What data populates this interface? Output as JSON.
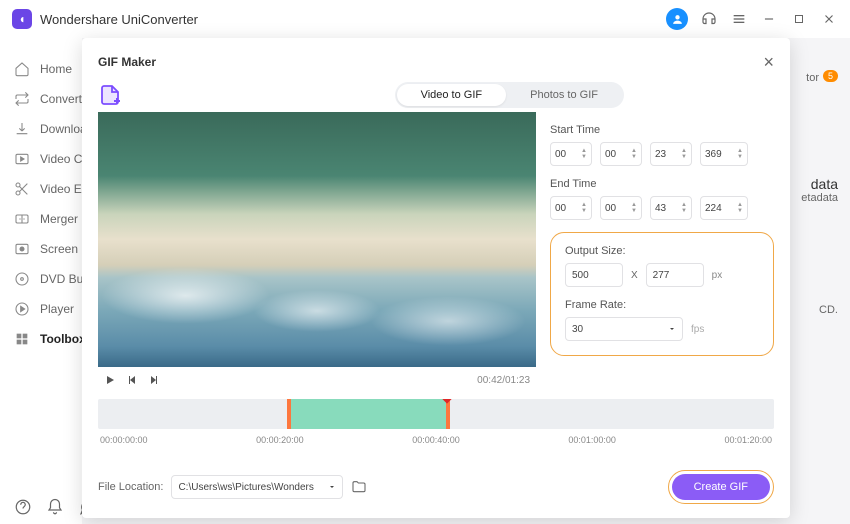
{
  "app": {
    "title": "Wondershare UniConverter"
  },
  "sidebar": {
    "items": [
      {
        "label": "Home"
      },
      {
        "label": "Converter"
      },
      {
        "label": "Downloader"
      },
      {
        "label": "Video Compressor"
      },
      {
        "label": "Video Editor"
      },
      {
        "label": "Merger"
      },
      {
        "label": "Screen Recorder"
      },
      {
        "label": "DVD Burner"
      },
      {
        "label": "Player"
      },
      {
        "label": "Toolbox"
      }
    ]
  },
  "right_peek": {
    "line1": "tor",
    "badge": "5",
    "line2": "data",
    "line3": "etadata",
    "line4": "CD."
  },
  "modal": {
    "title": "GIF Maker",
    "tabs": {
      "video": "Video to GIF",
      "photos": "Photos to GIF"
    },
    "start_label": "Start Time",
    "end_label": "End Time",
    "start_time": {
      "h": "00",
      "m": "00",
      "s": "23",
      "ms": "369"
    },
    "end_time": {
      "h": "00",
      "m": "00",
      "s": "43",
      "ms": "224"
    },
    "output_size_label": "Output Size:",
    "output_size": {
      "w": "500",
      "h": "277",
      "x": "X",
      "px": "px"
    },
    "frame_rate_label": "Frame Rate:",
    "frame_rate": {
      "value": "30",
      "unit": "fps"
    },
    "video_time": "00:42/01:23",
    "timeline_labels": [
      "00:00:00:00",
      "00:00:20:00",
      "00:00:40:00",
      "00:01:00:00",
      "00:01:20:00"
    ],
    "file_location_label": "File Location:",
    "file_location": "C:\\Users\\ws\\Pictures\\Wonders",
    "create_label": "Create GIF"
  }
}
